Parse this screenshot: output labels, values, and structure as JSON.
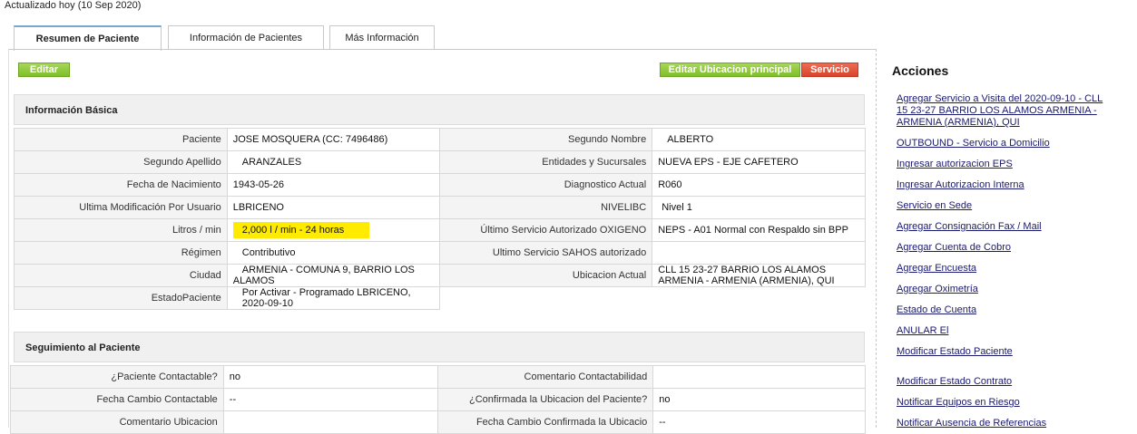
{
  "header": {
    "updated": "Actualizado hoy (10 Sep 2020)"
  },
  "tabs": [
    {
      "label": "Resumen de Paciente"
    },
    {
      "label": "Información de Pacientes"
    },
    {
      "label": "Más Información"
    }
  ],
  "toolbar": {
    "edit": "Editar",
    "edit_location": "Editar Ubicacion principal",
    "service": "Servicio"
  },
  "basic_info": {
    "title": "Información Básica",
    "rows": [
      {
        "l1": "Paciente",
        "v1": "JOSE MOSQUERA (CC: 7496486)",
        "l2": "Segundo Nombre",
        "v2": "ALBERTO"
      },
      {
        "l1": "Segundo Apellido",
        "v1": "ARANZALES",
        "l2": "Entidades y Sucursales",
        "v2": "NUEVA EPS - EJE CAFETERO"
      },
      {
        "l1": "Fecha de Nacimiento",
        "v1": "1943-05-26",
        "l2": "Diagnostico Actual",
        "v2": "R060"
      },
      {
        "l1": "Ultima Modificación Por Usuario",
        "v1": "LBRICENO",
        "l2": "NIVELIBC",
        "v2": "Nivel 1"
      },
      {
        "l1": "Litros / min",
        "v1": "2,000 l / min - 24 horas",
        "l2": "Último Servicio Autorizado OXIGENO",
        "v2": "NEPS - A01 Normal con Respaldo sin BPP"
      },
      {
        "l1": "Régimen",
        "v1": "Contributivo",
        "l2": "Ultimo Servicio SAHOS autorizado",
        "v2": ""
      },
      {
        "l1": "Ciudad",
        "v1": "ARMENIA - COMUNA 9, BARRIO LOS ALAMOS",
        "l2": "Ubicacion Actual",
        "v2": "CLL 15 23-27 BARRIO LOS ALAMOS ARMENIA - ARMENIA (ARMENIA), QUI"
      },
      {
        "l1": "EstadoPaciente",
        "v1": "Por Activar - Programado LBRICENO, 2020-09-10"
      }
    ]
  },
  "follow_up": {
    "title": "Seguimiento al Paciente",
    "rows": [
      {
        "l1": "¿Paciente Contactable?",
        "v1": "no",
        "l2": "Comentario Contactabilidad",
        "v2": ""
      },
      {
        "l1": "Fecha Cambio Contactable",
        "v1": "--",
        "l2": "¿Confirmada la Ubicacion del Paciente?",
        "v2": "no"
      },
      {
        "l1": "Comentario Ubicacion",
        "v1": "",
        "l2": "Fecha Cambio Confirmada la Ubicacio",
        "v2": "--"
      }
    ]
  },
  "actions": {
    "title": "Acciones",
    "links": [
      "Agregar Servicio a Visita del 2020-09-10 - CLL 15 23-27 BARRIO LOS ALAMOS ARMENIA - ARMENIA (ARMENIA), QUI",
      "OUTBOUND - Servicio a Domicilio",
      "Ingresar autorizacion EPS",
      "Ingresar Autorizacion Interna",
      "Servicio en Sede",
      "Agregar Consignación Fax / Mail",
      "Agregar Cuenta de Cobro",
      "Agregar Encuesta",
      "Agregar Oximetría",
      "Estado de Cuenta",
      "ANULAR El",
      "Modificar Estado Paciente",
      "Modificar Estado Contrato",
      "Notificar Equipos en Riesgo",
      "Notificar Ausencia de Referencias"
    ]
  }
}
